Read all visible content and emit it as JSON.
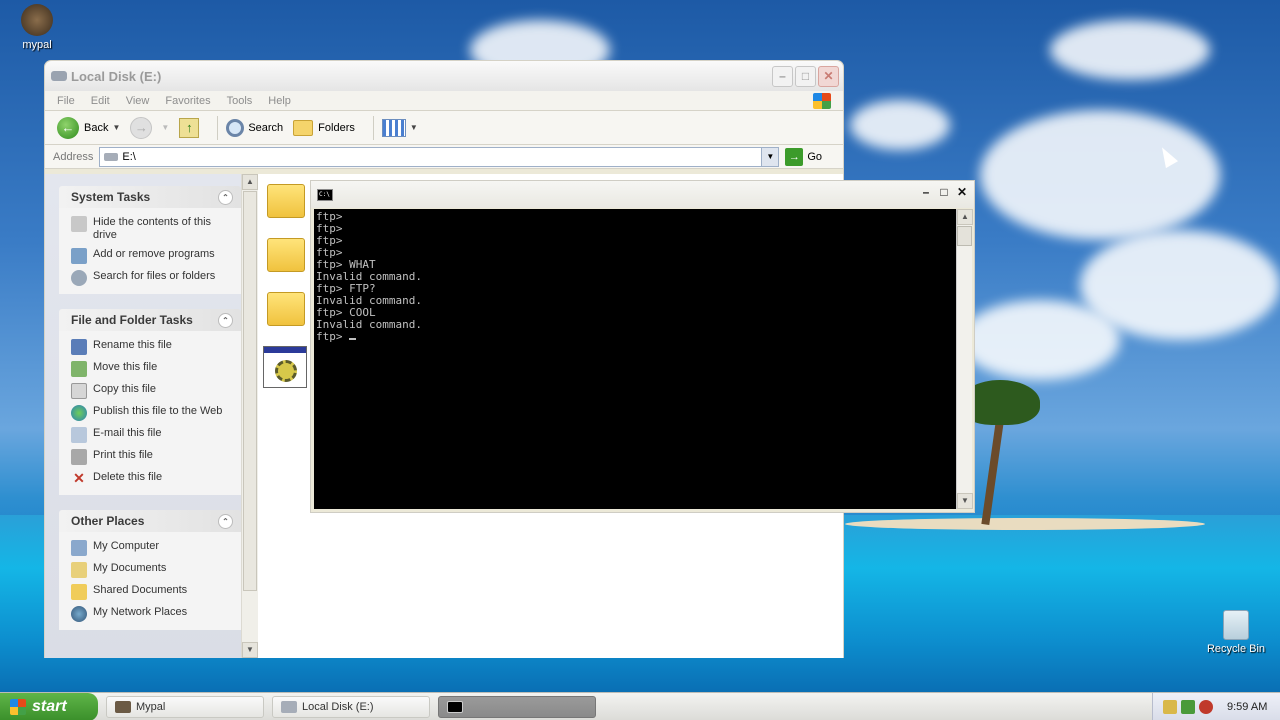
{
  "desktop": {
    "icons": {
      "mypal": "mypal",
      "recycle_bin": "Recycle Bin"
    }
  },
  "explorer": {
    "title": "Local Disk (E:)",
    "menu": [
      "File",
      "Edit",
      "View",
      "Favorites",
      "Tools",
      "Help"
    ],
    "toolbar": {
      "back": "Back",
      "search": "Search",
      "folders": "Folders"
    },
    "address": {
      "label": "Address",
      "value": "E:\\",
      "go": "Go"
    },
    "system_tasks": {
      "title": "System Tasks",
      "items": [
        "Hide the contents of this drive",
        "Add or remove programs",
        "Search for files or folders"
      ]
    },
    "file_folder_tasks": {
      "title": "File and Folder Tasks",
      "items": [
        "Rename this file",
        "Move this file",
        "Copy this file",
        "Publish this file to the Web",
        "E-mail this file",
        "Print this file",
        "Delete this file"
      ]
    },
    "other_places": {
      "title": "Other Places",
      "items": [
        "My Computer",
        "My Documents",
        "Shared Documents",
        "My Network Places"
      ]
    }
  },
  "console": {
    "title_icon_text": "C:\\",
    "lines": [
      "ftp>",
      "ftp>",
      "ftp>",
      "ftp>",
      "ftp> WHAT",
      "Invalid command.",
      "ftp> FTP?",
      "Invalid command.",
      "ftp> COOL",
      "Invalid command."
    ],
    "prompt": "ftp> "
  },
  "taskbar": {
    "start": "start",
    "buttons": [
      {
        "label": "Mypal"
      },
      {
        "label": "Local Disk (E:)"
      },
      {
        "label": ""
      }
    ],
    "clock": "9:59 AM"
  }
}
